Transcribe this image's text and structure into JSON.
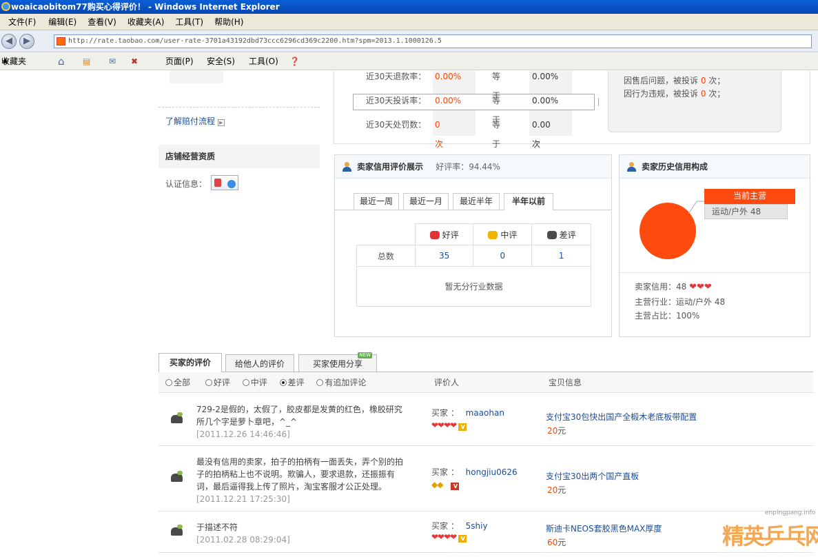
{
  "window": {
    "title": "woaicaobitom77购买心得评价！ - Windows Internet Explorer"
  },
  "menu": [
    "文件(F)",
    "编辑(E)",
    "查看(V)",
    "收藏夹(A)",
    "工具(T)",
    "帮助(H)"
  ],
  "address": {
    "url": "http://rate.taobao.com/user-rate-3701a43192dbd73ccc6296cd369c2200.htm?spm=2013.1.1000126.5"
  },
  "favbar": {
    "favorites": "收藏夹",
    "page": "页面(P)",
    "safety": "安全(S)",
    "tools": "工具(O)"
  },
  "left": {
    "payment_link": "了解赔付流程",
    "qualification_title": "店铺经营资质",
    "cert_label": "认证信息："
  },
  "metrics": [
    {
      "label": "近30天退款率：",
      "value": "0.00%",
      "compare": "等于",
      "avg": "0.00%"
    },
    {
      "label": "近30天投诉率：",
      "value": "0.00%",
      "compare": "等于",
      "avg": "0.00%"
    },
    {
      "label": "近30天处罚数：",
      "value": "0 次",
      "compare": "等于",
      "avg": "0.00 次"
    }
  ],
  "complaints": {
    "after_sale": {
      "prefix": "因售后问题，被投诉 ",
      "count": "0",
      "suffix": " 次；"
    },
    "violation": {
      "prefix": "因行为违规，被投诉 ",
      "count": "0",
      "suffix": " 次；"
    }
  },
  "credit_panel": {
    "title": "卖家信用评价展示",
    "rate_label": "好评率：94.44%",
    "tabs": [
      "最近一周",
      "最近一月",
      "最近半年",
      "半年以前"
    ],
    "active_tab": "半年以前",
    "headers": {
      "good": "好评",
      "neutral": "中评",
      "bad": "差评"
    },
    "row_label": "总数",
    "counts": {
      "good": "35",
      "neutral": "0",
      "bad": "1"
    },
    "industry_note": "暂无分行业数据"
  },
  "history_panel": {
    "title": "卖家历史信用构成",
    "main_label": "当前主营",
    "category": "运动/户外 48",
    "chart_data": {
      "type": "pie",
      "categories": [
        "运动/户外"
      ],
      "values": [
        48
      ]
    },
    "credit_line": "卖家信用：48",
    "industry_line": "主营行业：运动/户外  48",
    "share_line": "主营占比：100%"
  },
  "reviews_tabs": {
    "buyer": "买家的评价",
    "given": "给他人的评价",
    "share": "买家使用分享",
    "new_badge": "NEW"
  },
  "filters": {
    "all": "全部",
    "good": "好评",
    "neutral": "中评",
    "bad": "差评",
    "appended": "有追加评论",
    "rater_col": "评价人",
    "item_col": "宝贝信息"
  },
  "reviews": [
    {
      "text": "729-2是假的，太假了，胶皮都是发黄的红色，橡胶研究所几个字是萝卜章吧，^_^",
      "date": "[2011.12.26 14:46:46]",
      "buyer_label": "买家 ：",
      "buyer": "maaohan",
      "hearts": "❤❤❤❤",
      "item": "支付宝30包快出国产全椴木老底板带配置",
      "price": "20",
      "unit": "元"
    },
    {
      "text": "最没有信用的卖家，拍子的拍柄有一面丢失，弄个别的拍子的拍柄粘上也不说明。欺骗人，要求退款，还振振有词，最后逼得我上传了照片，淘宝客服才公正处理。",
      "date": "[2011.12.21 17:25:30]",
      "buyer_label": "买家 ：",
      "buyer": "hongjiu0626",
      "hearts": "◆◆",
      "item": "支付宝30出两个国产直板",
      "price": "20",
      "unit": "元"
    },
    {
      "text": "于描述不符",
      "date": "[2011.02.28 08:29:04]",
      "buyer_label": "买家 ：",
      "buyer": "5shiy",
      "hearts": "❤❤❤❤",
      "item": "斯迪卡NEOS套胶黑色MAX厚度",
      "price": "60",
      "unit": "元"
    }
  ],
  "watermark": {
    "site": "enpingpang.info",
    "name": "精英乒乓网"
  }
}
